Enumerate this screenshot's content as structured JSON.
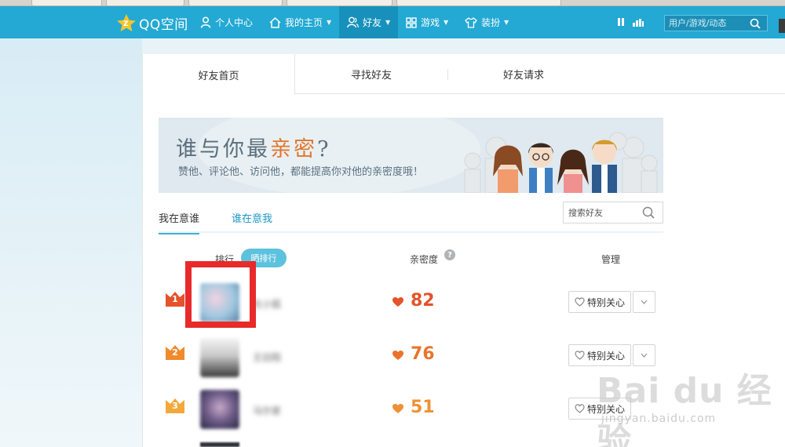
{
  "nav": {
    "logo_text": "QQ空间",
    "items": [
      {
        "label": "个人中心"
      },
      {
        "label": "我的主页"
      },
      {
        "label": "好友"
      },
      {
        "label": "游戏"
      },
      {
        "label": "装扮"
      }
    ],
    "search_placeholder": "用户/游戏/动态"
  },
  "tabs": [
    {
      "label": "好友首页"
    },
    {
      "label": "寻找好友"
    },
    {
      "label": "好友请求"
    }
  ],
  "banner": {
    "title_pre": "谁与你最",
    "title_hl": "亲密",
    "title_post": "?",
    "subtitle": "赞他、评论他、访问他，都能提高你对他的亲密度哦！"
  },
  "subtabs": {
    "mine": "我在意谁",
    "theirs": "谁在意我",
    "search_placeholder": "搜索好友"
  },
  "columns": {
    "rank": "排行",
    "show_rank": "晒排行",
    "intimacy": "亲密度",
    "manage": "管理"
  },
  "rows": [
    {
      "rank": "1",
      "name": "杜小狐",
      "intimacy": "82",
      "care_label": "特别关心",
      "badge_color": "#e5532a"
    },
    {
      "rank": "2",
      "name": "王旧陌",
      "intimacy": "76",
      "care_label": "特别关心",
      "badge_color": "#f08a2e"
    },
    {
      "rank": "3",
      "name": "马尔家",
      "intimacy": "51",
      "care_label": "特别关心",
      "badge_color": "#f3a93a"
    }
  ],
  "watermark": {
    "brand": "Bai du 经验",
    "url": "jingyan.baidu.com"
  }
}
